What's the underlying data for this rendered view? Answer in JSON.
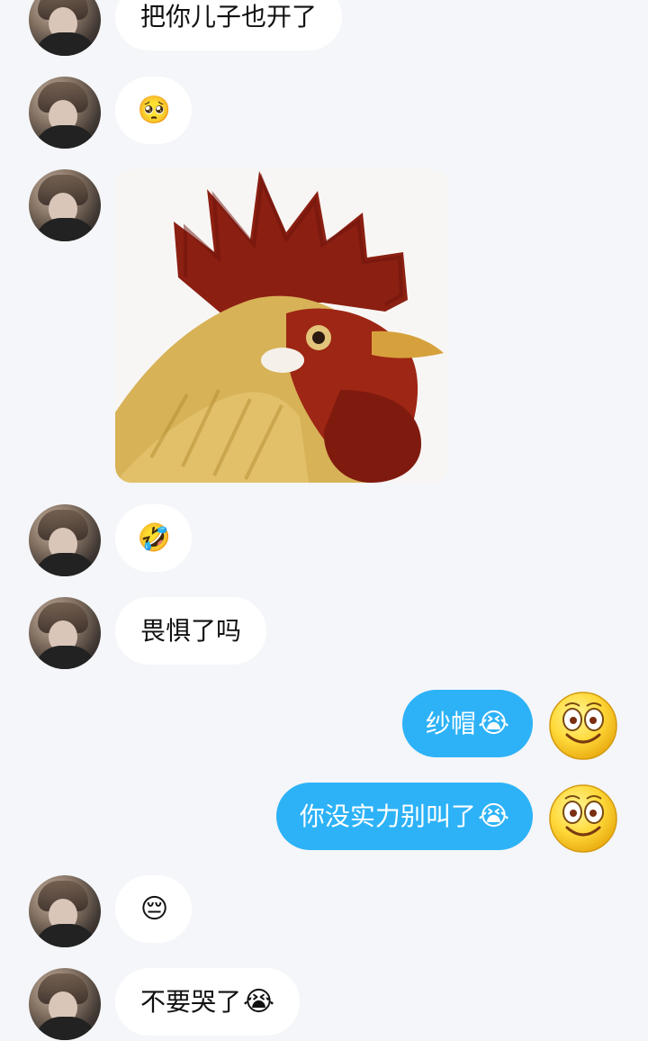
{
  "messages": [
    {
      "id": 1,
      "side": "left",
      "text": "把你儿子也开了"
    },
    {
      "id": 2,
      "side": "left",
      "emoji": "🥺"
    },
    {
      "id": 3,
      "side": "left",
      "image": "rooster-photo"
    },
    {
      "id": 4,
      "side": "left",
      "emoji": "🤣"
    },
    {
      "id": 5,
      "side": "left",
      "text": "畏惧了吗"
    },
    {
      "id": 6,
      "side": "right",
      "text": "纱帽",
      "emoji": "😭"
    },
    {
      "id": 7,
      "side": "right",
      "text": "你没实力别叫了",
      "emoji": "😭"
    },
    {
      "id": 8,
      "side": "left",
      "emoji": "😔"
    },
    {
      "id": 9,
      "side": "left",
      "text": "不要哭了",
      "emoji": "😭"
    }
  ],
  "colors": {
    "background": "#f4f6f9",
    "left_bubble": "#ffffff",
    "right_bubble": "#2db2f7",
    "right_text": "#ffffff"
  },
  "icons": {
    "contact_avatar": "user-photo-avatar",
    "self_avatar": "smiley-face-avatar-icon"
  }
}
